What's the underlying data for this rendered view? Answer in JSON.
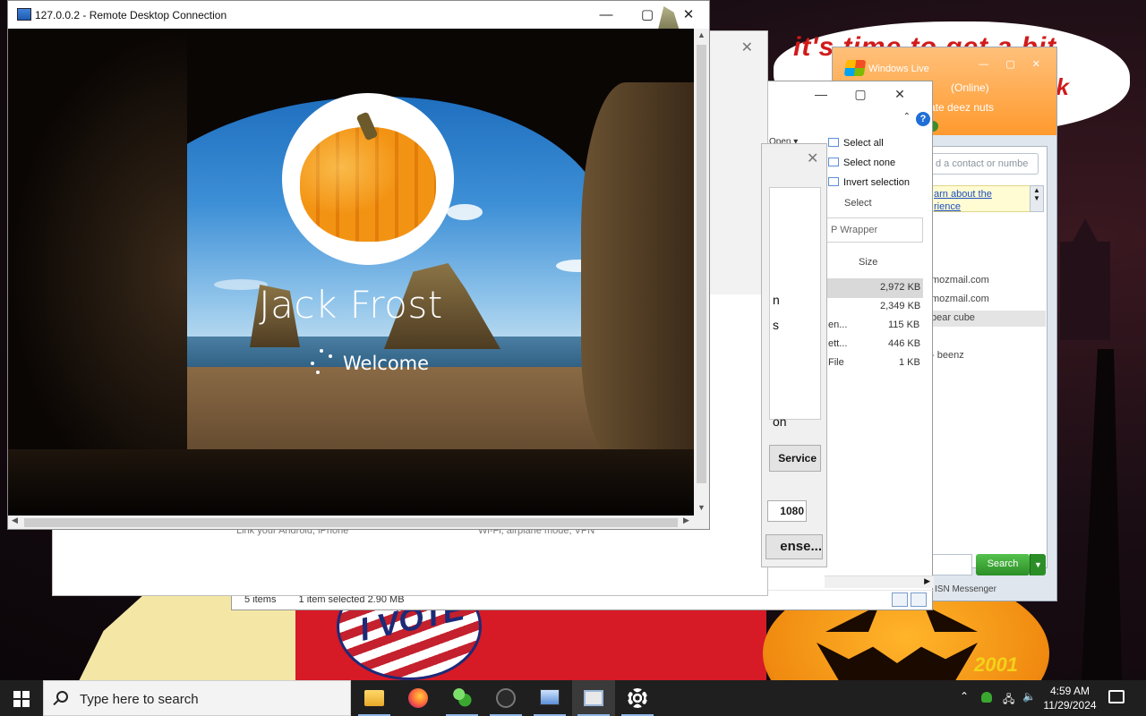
{
  "wallpaper": {
    "bubble_line1": "it's time to get a bit",
    "bubble_line2": "ck",
    "sticker_text": "I VOTE",
    "signature": "2001"
  },
  "msn": {
    "title": "Windows Live",
    "status": "(Online)",
    "personal_message": "rate deez nuts",
    "search_placeholder": "d a contact or numbe",
    "banner_line1": "arn about the",
    "banner_line2": "rience",
    "contacts": [
      "mozmail.com",
      "mozmail.com",
      "bear cube",
      "- beenz"
    ],
    "search_button": "Search",
    "footer": "ISN Messenger"
  },
  "explorer": {
    "ribbon": {
      "open_label": "Open ▾",
      "select_all": "Select all",
      "select_none": "Select none",
      "invert_selection": "Invert selection",
      "group_label": "Select"
    },
    "search_placeholder": "P Wrapper",
    "column_size": "Size",
    "rows": [
      {
        "type": "",
        "size": "2,972 KB"
      },
      {
        "type": "",
        "size": "2,349 KB"
      },
      {
        "type": "en...",
        "size": "115 KB"
      },
      {
        "type": "ett...",
        "size": "446 KB"
      },
      {
        "type": "File",
        "size": "1 KB"
      }
    ],
    "status": {
      "items": "5 items",
      "selected": "1 item selected  2.90 MB"
    }
  },
  "settings": {
    "item_left": "Link your Android, iPhone",
    "item_right": "Wi-Fi, airplane mode, VPN"
  },
  "dialog": {
    "text_a": "n",
    "text_b": "s",
    "text_c": "on",
    "service_button": "Service",
    "port_value": "1080",
    "license_button": "ense..."
  },
  "rdp": {
    "title": "127.0.0.2 - Remote Desktop Connection",
    "user_name": "Jack Frost",
    "welcome": "Welcome"
  },
  "taskbar": {
    "search_placeholder": "Type here to search",
    "apps": [
      "file-explorer",
      "firefox",
      "messenger",
      "app-dark",
      "remote-desktop",
      "notepad-window",
      "settings"
    ],
    "clock_time": "4:59 AM",
    "clock_date": "11/29/2024"
  }
}
